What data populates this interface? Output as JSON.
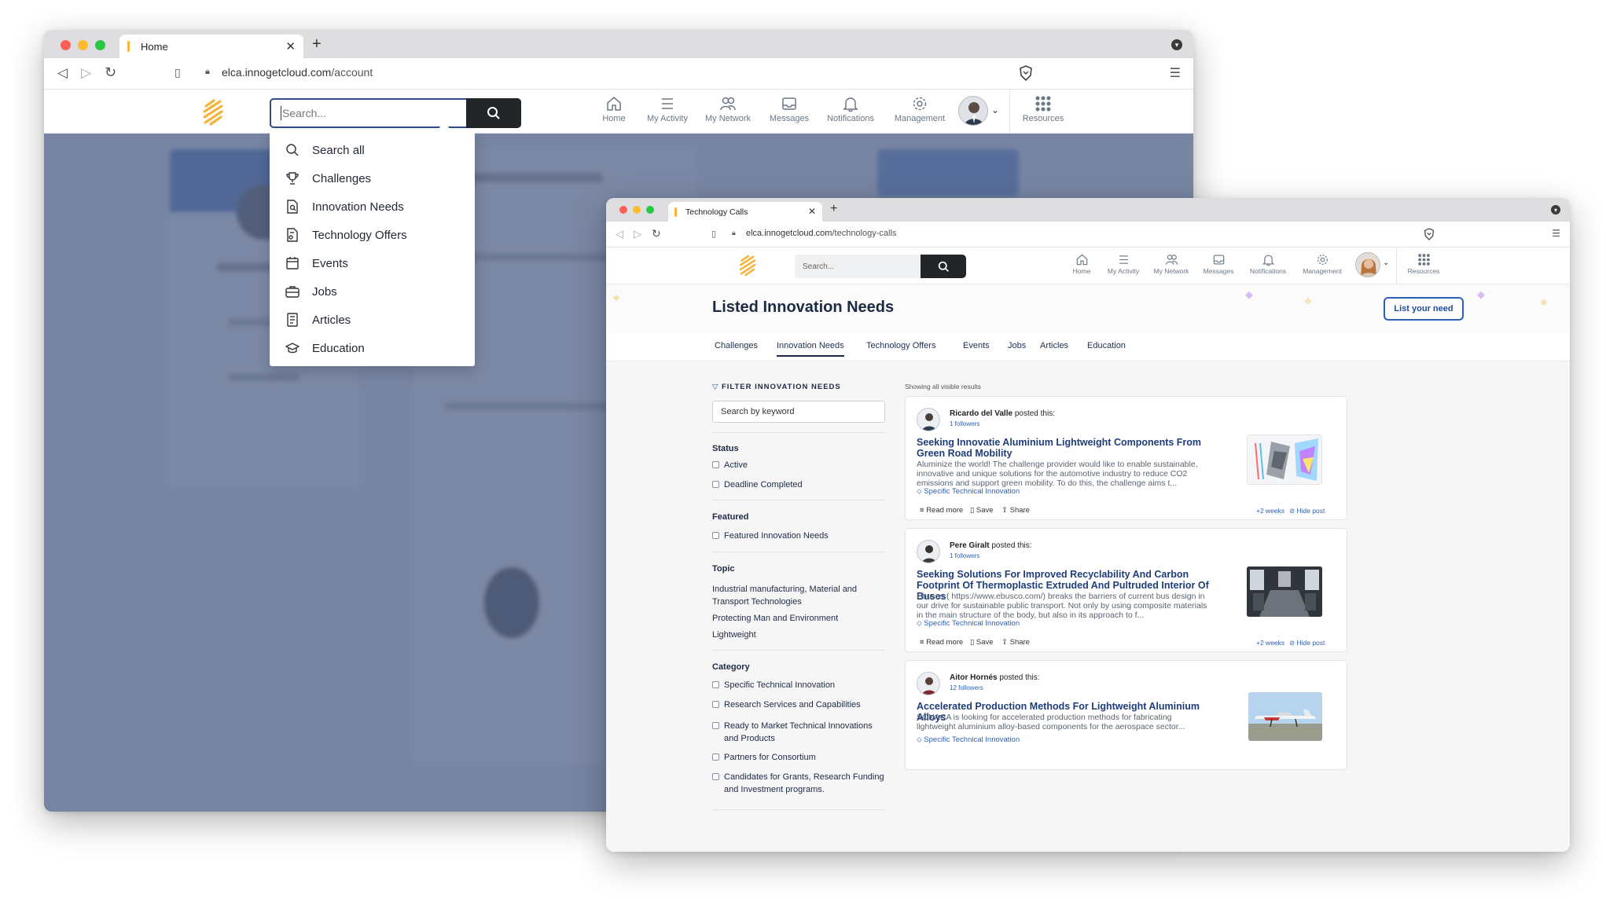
{
  "colors": {
    "accent": "#2d4e8a",
    "overlay": "#56678c",
    "logo": "#f5b43c",
    "link": "#1f3d79"
  },
  "back_window": {
    "tab_title": "Home",
    "url_host": "elca.innogetcloud.com",
    "url_path": "/account",
    "search_placeholder": "Search...",
    "nav": [
      {
        "label": "Home",
        "icon": "home-icon"
      },
      {
        "label": "My Activity",
        "icon": "activity-list-icon"
      },
      {
        "label": "My Network",
        "icon": "network-icon"
      },
      {
        "label": "Messages",
        "icon": "messages-icon"
      },
      {
        "label": "Notifications",
        "icon": "bell-icon"
      },
      {
        "label": "Management",
        "icon": "gear-icon"
      },
      {
        "label": "Resources",
        "icon": "grid-icon"
      }
    ],
    "dropdown": [
      {
        "label": "Search all",
        "icon": "search-icon"
      },
      {
        "label": "Challenges",
        "icon": "trophy-icon"
      },
      {
        "label": "Innovation Needs",
        "icon": "document-search-icon"
      },
      {
        "label": "Technology Offers",
        "icon": "document-icon"
      },
      {
        "label": "Events",
        "icon": "calendar-icon"
      },
      {
        "label": "Jobs",
        "icon": "briefcase-icon"
      },
      {
        "label": "Articles",
        "icon": "article-icon"
      },
      {
        "label": "Education",
        "icon": "graduation-cap-icon"
      }
    ]
  },
  "front_window": {
    "tab_title": "Technology Calls",
    "url_host": "elca.innogetcloud.com",
    "url_path": "/technology-calls",
    "search_placeholder": "Search...",
    "page_title": "Listed Innovation Needs",
    "list_button": "List your need",
    "subtabs": [
      "Challenges",
      "Innovation Needs",
      "Technology Offers",
      "Events",
      "Jobs",
      "Articles",
      "Education"
    ],
    "active_subtab": "Innovation Needs",
    "filter": {
      "heading": "FILTER INNOVATION NEEDS",
      "search_placeholder": "Search by keyword",
      "status_heading": "Status",
      "status": [
        "Active",
        "Deadline Completed"
      ],
      "featured_heading": "Featured",
      "featured": [
        "Featured Innovation Needs"
      ],
      "topic_heading": "Topic",
      "topics": [
        "Industrial manufacturing, Material and Transport Technologies",
        "Protecting Man and Environment",
        "Lightweight"
      ],
      "category_heading": "Category",
      "categories": [
        "Specific Technical Innovation",
        "Research Services and Capabilities",
        "Ready to Market Technical Innovations and Products",
        "Partners for Consortium",
        "Candidates for Grants, Research Funding and Investment programs."
      ]
    },
    "results_label": "Showing all visible results",
    "posts": [
      {
        "author": "Ricardo del Valle",
        "posted": "posted this:",
        "followers": "1 followers",
        "title": "Seeking Innovatie Aluminium Lightweight Components From Green Road Mobility",
        "desc": "Aluminize the world! The challenge provider would like to enable sustainable, innovative and unique solutions for the automotive industry to reduce CO2 emissions and support green mobility. To do this, the challenge aims t...",
        "tag": "Specific Technical Innovation",
        "read": "Read more",
        "save": "Save",
        "share": "Share",
        "age": "+2 weeks",
        "hide": "Hide post"
      },
      {
        "author": "Pere Giralt",
        "posted": "posted this:",
        "followers": "1 followers",
        "title": "Seeking Solutions For Improved Recyclability And Carbon Footprint Of Thermoplastic Extruded And Pultruded Interior Of Buses",
        "desc": "Ebusco ( https://www.ebusco.com/) breaks the barriers of current bus design in our drive for sustainable public transport. Not only by using composite materials in the main structure of the body, but also in its approach to f...",
        "tag": "Specific Technical Innovation",
        "read": "Read more",
        "save": "Save",
        "share": "Share",
        "age": "+2 weeks",
        "hide": "Hide post"
      },
      {
        "author": "Aitor Hornés",
        "posted": "posted this:",
        "followers": "12 followers",
        "title": "Accelerated Production Methods For Lightweight Aluminium Alloys",
        "desc": "SONACA is looking for accelerated production methods for fabricating lightweight aluminium alloy-based components for the aerospace sector...",
        "tag": "Specific Technical Innovation"
      }
    ]
  }
}
